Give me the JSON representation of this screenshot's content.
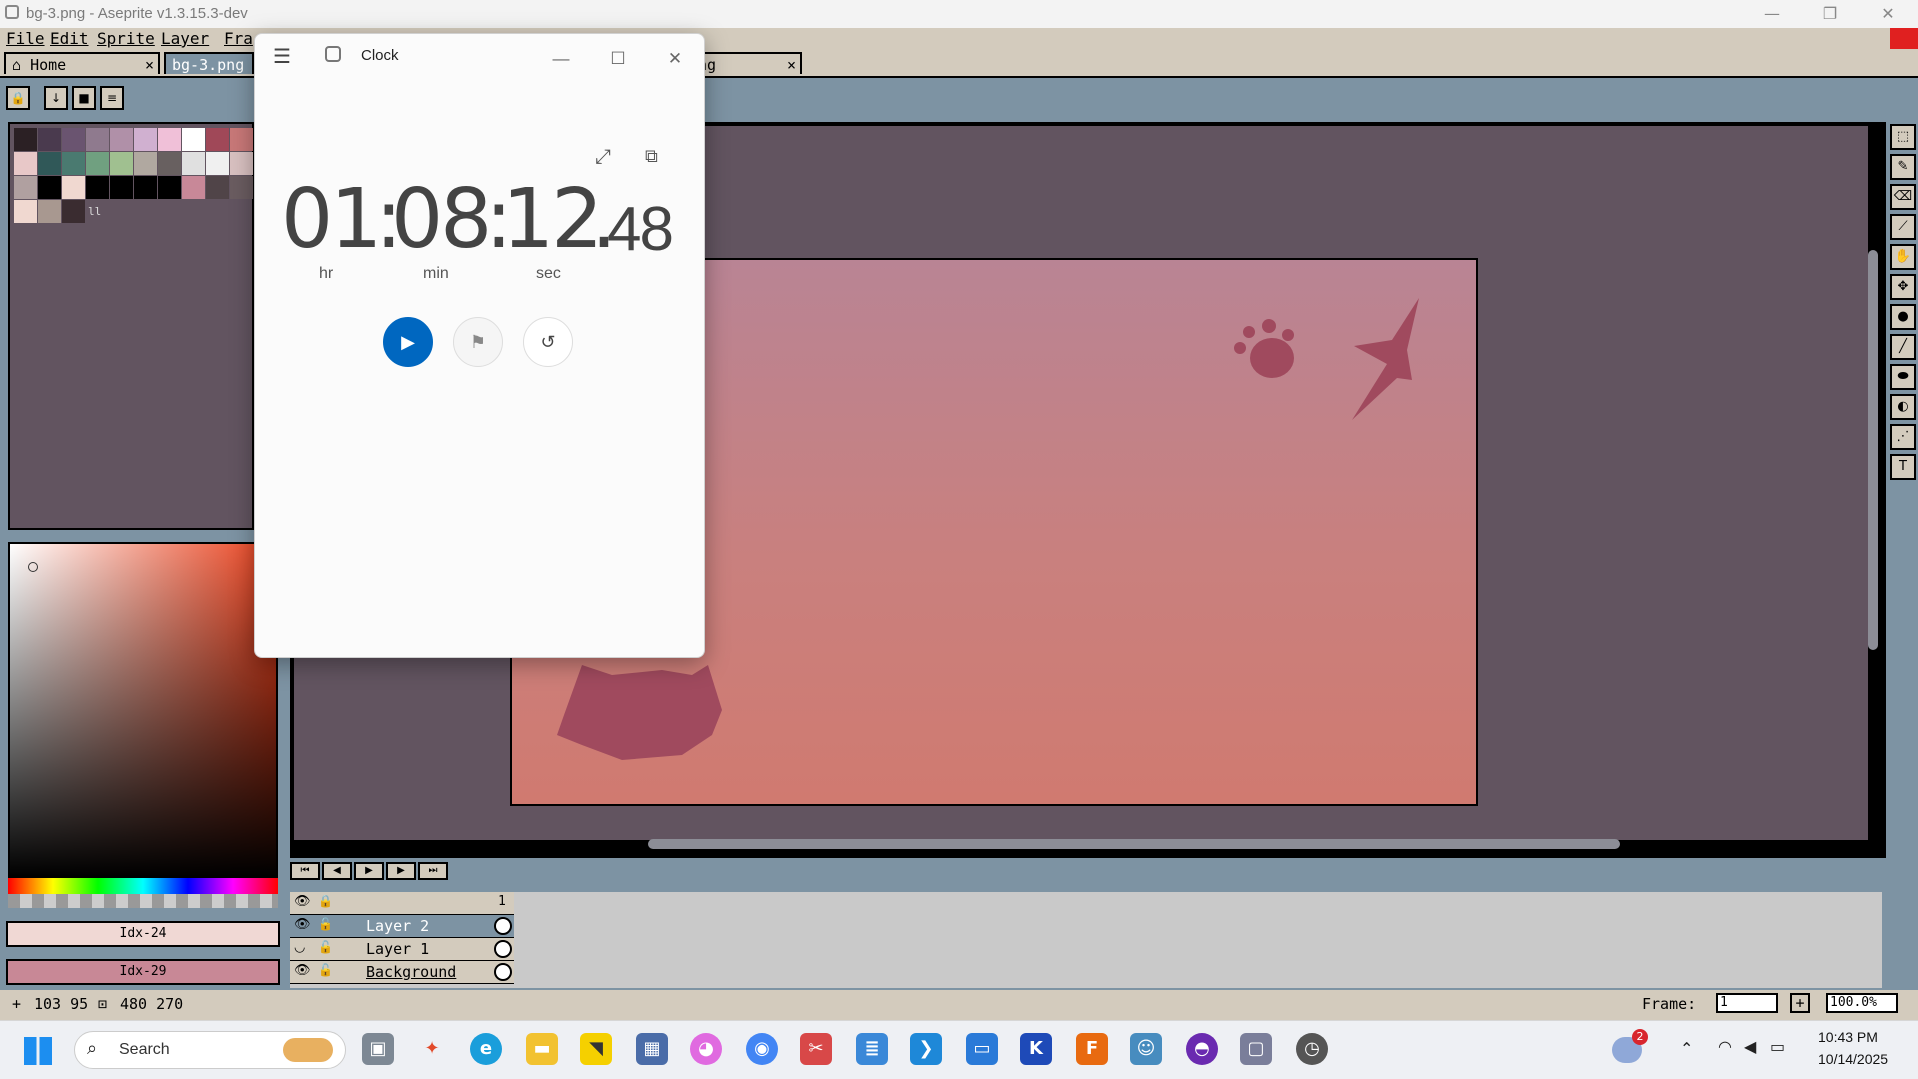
{
  "aseprite": {
    "window_title": "bg-3.png - Aseprite v1.3.15.3-dev",
    "menus": [
      "File",
      "Edit",
      "Sprite",
      "Layer",
      "Fra"
    ],
    "tabs": [
      {
        "label": "Home",
        "close": "×"
      },
      {
        "label": "bg-3.png"
      },
      {
        "label": "ng",
        "close": "×"
      }
    ],
    "palette_marker": "ll",
    "fg_color_label": "Idx-24",
    "bg_color_label": "Idx-29",
    "layers": [
      {
        "name": "Layer 2"
      },
      {
        "name": "Layer 1"
      },
      {
        "name": "Background"
      }
    ],
    "frame_header": "1",
    "status": {
      "cursor_pos": "103  95",
      "sprite_size": "480 270",
      "frame_label": "Frame:",
      "frame_value": "1",
      "zoom_value": "100.0%"
    },
    "colors": {
      "palette": [
        "#2b2024",
        "#4a3a4e",
        "#6a5470",
        "#8f7a8e",
        "#b090a8",
        "#d0b0d0",
        "#f0c0d8",
        "#ffffff",
        "#a04858",
        "#c87878",
        "#e8c8c8",
        "#305858",
        "#4a7a70",
        "#70a080",
        "#a0c090",
        "#b0a8a0",
        "#686060",
        "#e0e0e0",
        "#f0f0f0",
        "#d8c0c0",
        "#b0a0a0",
        "#000000",
        "#f0d8d0",
        "#000000",
        "#000000",
        "#000000",
        "#000000",
        "#c88898",
        "#504448",
        "#6a5c60",
        "#f0d8d0",
        "#a89890",
        "#3a2c30"
      ]
    }
  },
  "clock": {
    "title": "Clock",
    "hours": "01",
    "minutes": "08",
    "seconds": "12",
    "hundredths": "48",
    "sep": ":",
    "dot": ".",
    "unit_hr": "hr",
    "unit_min": "min",
    "unit_sec": "sec"
  },
  "taskbar": {
    "search_placeholder": "Search",
    "time": "10:43 PM",
    "date": "10/14/2025",
    "weather_badge": "2"
  }
}
